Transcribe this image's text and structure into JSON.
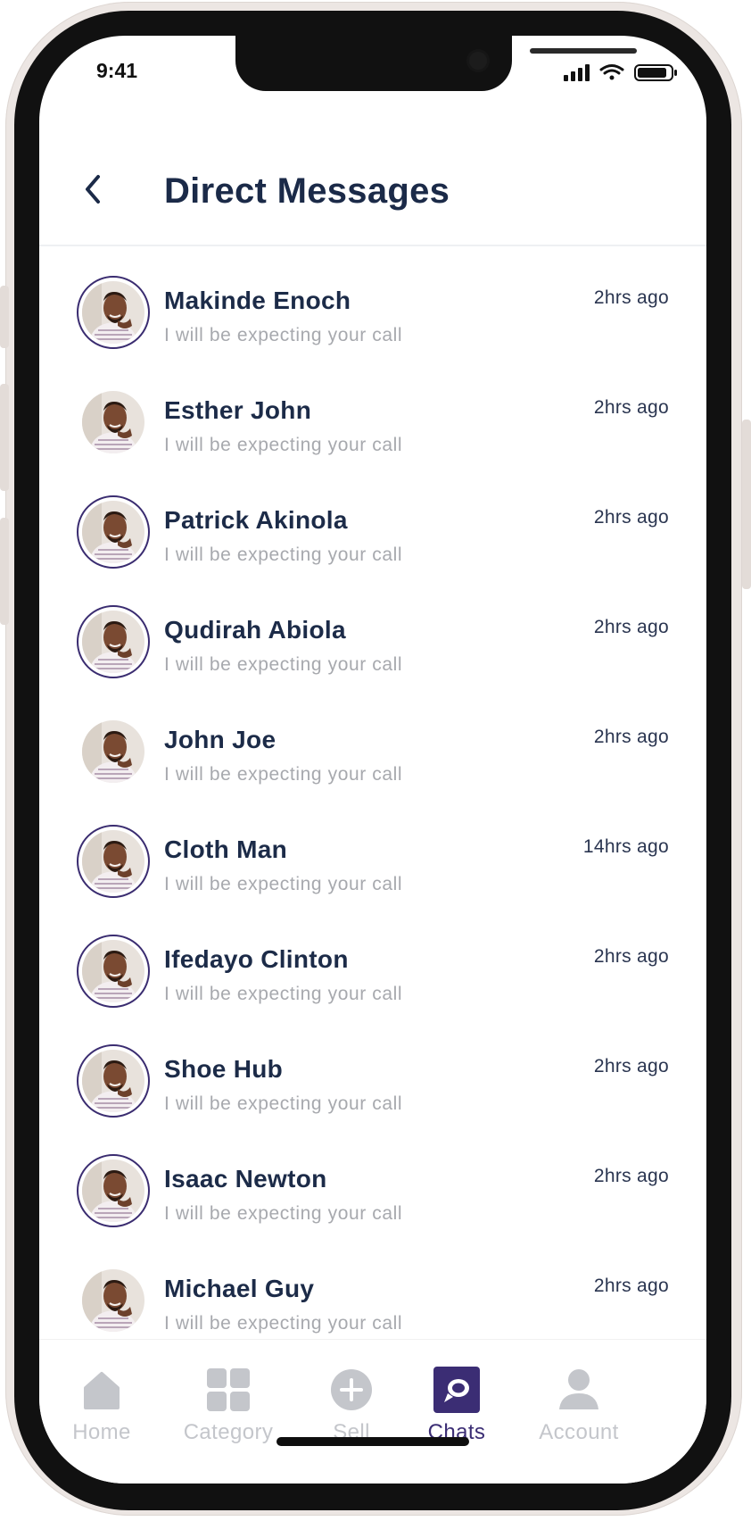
{
  "status_bar": {
    "time": "9:41"
  },
  "header": {
    "title": "Direct Messages"
  },
  "conversations": [
    {
      "name": "Makinde Enoch",
      "preview": "I will be expecting your call",
      "time": "2hrs ago",
      "ring": true
    },
    {
      "name": "Esther John",
      "preview": "I will be expecting your call",
      "time": "2hrs ago",
      "ring": false
    },
    {
      "name": "Patrick Akinola",
      "preview": "I will be expecting your call",
      "time": "2hrs ago",
      "ring": true
    },
    {
      "name": "Qudirah Abiola",
      "preview": "I will be expecting your call",
      "time": "2hrs ago",
      "ring": true
    },
    {
      "name": "John Joe",
      "preview": "I will be expecting your call",
      "time": "2hrs ago",
      "ring": false
    },
    {
      "name": "Cloth Man",
      "preview": "I will be expecting your call",
      "time": "14hrs ago",
      "ring": true
    },
    {
      "name": "Ifedayo Clinton",
      "preview": "I will be expecting your call",
      "time": "2hrs ago",
      "ring": true
    },
    {
      "name": "Shoe Hub",
      "preview": "I will be expecting your call",
      "time": "2hrs ago",
      "ring": true
    },
    {
      "name": "Isaac Newton",
      "preview": "I will be expecting your call",
      "time": "2hrs ago",
      "ring": true
    },
    {
      "name": "Michael Guy",
      "preview": "I will be expecting your call",
      "time": "2hrs ago",
      "ring": false
    }
  ],
  "tabs": [
    {
      "label": "Home",
      "icon": "home-icon"
    },
    {
      "label": "Category",
      "icon": "grid-icon"
    },
    {
      "label": "Sell",
      "icon": "plus-circle-icon"
    },
    {
      "label": "Chats",
      "icon": "chat-icon",
      "active": true
    },
    {
      "label": "Account",
      "icon": "user-icon"
    }
  ],
  "colors": {
    "accent": "#3b2d74",
    "title": "#1b2a48",
    "muted": "#a7a9ae",
    "tab_inactive": "#c4c6cb"
  }
}
